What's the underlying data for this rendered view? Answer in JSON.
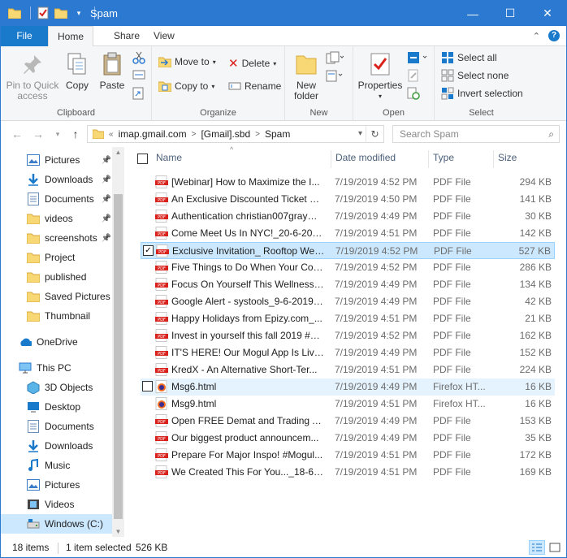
{
  "window": {
    "title": "Spam"
  },
  "tabs": {
    "file": "File",
    "home": "Home",
    "share": "Share",
    "view": "View"
  },
  "ribbon": {
    "clipboard": {
      "label": "Clipboard",
      "pin": "Pin to Quick access",
      "pin_l1": "Pin to Quick",
      "pin_l2": "access",
      "copy": "Copy",
      "paste": "Paste"
    },
    "organize": {
      "label": "Organize",
      "move_to": "Move to",
      "copy_to": "Copy to",
      "delete": "Delete",
      "rename": "Rename"
    },
    "new": {
      "label": "New",
      "new_folder_l1": "New",
      "new_folder_l2": "folder"
    },
    "open": {
      "label": "Open",
      "properties": "Properties"
    },
    "select": {
      "label": "Select",
      "select_all": "Select all",
      "select_none": "Select none",
      "invert": "Invert selection"
    }
  },
  "address": {
    "crumbs": [
      "imap.gmail.com",
      "[Gmail].sbd",
      "Spam"
    ],
    "overflow": "«",
    "search_placeholder": "Search Spam"
  },
  "nav": {
    "items": [
      {
        "label": "Pictures",
        "icon": "pictures-icon",
        "pinned": true
      },
      {
        "label": "Downloads",
        "icon": "downloads-icon",
        "pinned": true
      },
      {
        "label": "Documents",
        "icon": "documents-icon",
        "pinned": true
      },
      {
        "label": "videos",
        "icon": "folder-icon",
        "pinned": true
      },
      {
        "label": "screenshots",
        "icon": "folder-icon",
        "pinned": true
      },
      {
        "label": "Project",
        "icon": "folder-icon",
        "pinned": false
      },
      {
        "label": "published",
        "icon": "folder-icon",
        "pinned": false
      },
      {
        "label": "Saved Pictures",
        "icon": "folder-icon",
        "pinned": false
      },
      {
        "label": "Thumbnail",
        "icon": "folder-icon",
        "pinned": false
      },
      {
        "label": "OneDrive",
        "icon": "onedrive-icon",
        "pinned": false
      },
      {
        "label": "This PC",
        "icon": "this-pc-icon",
        "pinned": false
      },
      {
        "label": "3D Objects",
        "icon": "3d-objects-icon",
        "pinned": false
      },
      {
        "label": "Desktop",
        "icon": "desktop-icon",
        "pinned": false
      },
      {
        "label": "Documents",
        "icon": "documents-icon",
        "pinned": false
      },
      {
        "label": "Downloads",
        "icon": "downloads-icon",
        "pinned": false
      },
      {
        "label": "Music",
        "icon": "music-icon",
        "pinned": false
      },
      {
        "label": "Pictures",
        "icon": "pictures-icon",
        "pinned": false
      },
      {
        "label": "Videos",
        "icon": "videos-icon",
        "pinned": false
      },
      {
        "label": "Windows (C:)",
        "icon": "drive-icon",
        "pinned": false,
        "selected": true
      }
    ]
  },
  "columns": {
    "name": "Name",
    "date": "Date modified",
    "type": "Type",
    "size": "Size"
  },
  "files": [
    {
      "name": "[Webinar] How to Maximize the I...",
      "date": "7/19/2019 4:52 PM",
      "type": "PDF File",
      "size": "294 KB",
      "icon": "pdf-icon"
    },
    {
      "name": "An Exclusive Discounted Ticket Ju...",
      "date": "7/19/2019 4:50 PM",
      "type": "PDF File",
      "size": "141 KB",
      "icon": "pdf-icon"
    },
    {
      "name": "Authentication christian007gray@...",
      "date": "7/19/2019 4:49 PM",
      "type": "PDF File",
      "size": "30 KB",
      "icon": "pdf-icon"
    },
    {
      "name": "Come Meet Us In NYC!_20-6-2019....",
      "date": "7/19/2019 4:51 PM",
      "type": "PDF File",
      "size": "142 KB",
      "icon": "pdf-icon"
    },
    {
      "name": "Exclusive Invitation_ Rooftop Well...",
      "date": "7/19/2019 4:52 PM",
      "type": "PDF File",
      "size": "527 KB",
      "icon": "pdf-icon",
      "selected": true
    },
    {
      "name": "Five Things to Do When Your Con...",
      "date": "7/19/2019 4:52 PM",
      "type": "PDF File",
      "size": "286 KB",
      "icon": "pdf-icon"
    },
    {
      "name": "Focus On Yourself This Wellness ...",
      "date": "7/19/2019 4:49 PM",
      "type": "PDF File",
      "size": "134 KB",
      "icon": "pdf-icon"
    },
    {
      "name": "Google Alert - systools_9-6-2019....",
      "date": "7/19/2019 4:49 PM",
      "type": "PDF File",
      "size": "42 KB",
      "icon": "pdf-icon"
    },
    {
      "name": "Happy Holidays from Epizy.com_...",
      "date": "7/19/2019 4:51 PM",
      "type": "PDF File",
      "size": "21 KB",
      "icon": "pdf-icon"
    },
    {
      "name": "Invest in yourself this fall 2019 #M...",
      "date": "7/19/2019 4:52 PM",
      "type": "PDF File",
      "size": "162 KB",
      "icon": "pdf-icon"
    },
    {
      "name": "IT'S HERE! Our Mogul App Is Live!...",
      "date": "7/19/2019 4:49 PM",
      "type": "PDF File",
      "size": "152 KB",
      "icon": "pdf-icon"
    },
    {
      "name": "KredX - An Alternative Short-Ter...",
      "date": "7/19/2019 4:51 PM",
      "type": "PDF File",
      "size": "224 KB",
      "icon": "pdf-icon"
    },
    {
      "name": "Msg6.html",
      "date": "7/19/2019 4:49 PM",
      "type": "Firefox HT...",
      "size": "16 KB",
      "icon": "firefox-icon",
      "hover": true
    },
    {
      "name": "Msg9.html",
      "date": "7/19/2019 4:51 PM",
      "type": "Firefox HT...",
      "size": "16 KB",
      "icon": "firefox-icon"
    },
    {
      "name": "Open FREE Demat and Trading Ac...",
      "date": "7/19/2019 4:49 PM",
      "type": "PDF File",
      "size": "153 KB",
      "icon": "pdf-icon"
    },
    {
      "name": "Our biggest product announcem...",
      "date": "7/19/2019 4:49 PM",
      "type": "PDF File",
      "size": "35 KB",
      "icon": "pdf-icon"
    },
    {
      "name": "Prepare For Major Inspo! #Mogul...",
      "date": "7/19/2019 4:51 PM",
      "type": "PDF File",
      "size": "172 KB",
      "icon": "pdf-icon"
    },
    {
      "name": "We Created This For You..._18-6-2...",
      "date": "7/19/2019 4:51 PM",
      "type": "PDF File",
      "size": "169 KB",
      "icon": "pdf-icon"
    }
  ],
  "status": {
    "count": "18 items",
    "selected": "1 item selected",
    "size": "526 KB"
  },
  "colors": {
    "titlebar": "#2b79d0",
    "file_tab": "#1979ca",
    "selection": "#cce8ff",
    "pdf_red": "#d9221c",
    "folder": "#f8d775"
  }
}
